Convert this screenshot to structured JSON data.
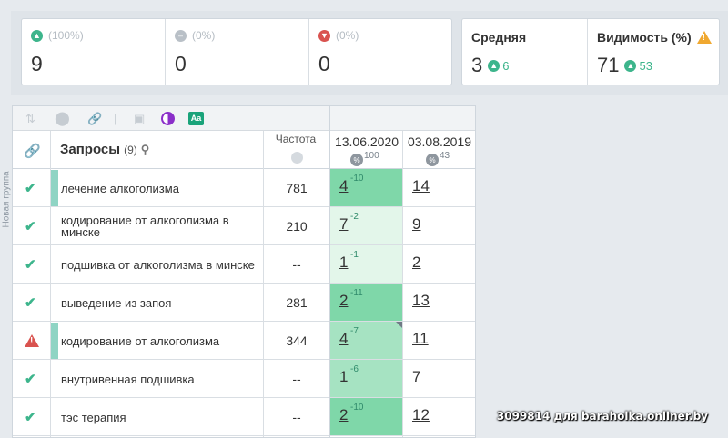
{
  "stats": {
    "up": {
      "pct": "(100%)",
      "value": "9"
    },
    "flat": {
      "pct": "(0%)",
      "value": "0"
    },
    "down": {
      "pct": "(0%)",
      "value": "0"
    }
  },
  "average": {
    "label": "Средняя",
    "value": "3",
    "delta": "6"
  },
  "visibility": {
    "label": "Видимость (%)",
    "value": "71",
    "delta": "53"
  },
  "sidebar": {
    "group_label": "Новая группа"
  },
  "table": {
    "query_title": "Запросы",
    "query_count": "(9)",
    "freq_header": "Частота",
    "date1": "13.06.2020",
    "date1_badge": "100",
    "date2": "03.08.2019",
    "date2_badge": "43",
    "rows": [
      {
        "status": "ok",
        "query": "лечение алкоголизма",
        "freq": "781",
        "pos1": "4",
        "delta1": "-10",
        "pos2": "14",
        "marker": true,
        "bg": "#7fd7a9"
      },
      {
        "status": "ok",
        "query": "кодирование от алкоголизма в минске",
        "freq": "210",
        "pos1": "7",
        "delta1": "-2",
        "pos2": "9",
        "marker": false,
        "bg": "#e3f6ea"
      },
      {
        "status": "ok",
        "query": "подшивка от алкоголизма в минске",
        "freq": "--",
        "pos1": "1",
        "delta1": "-1",
        "pos2": "2",
        "marker": false,
        "bg": "#e3f6ea"
      },
      {
        "status": "ok",
        "query": "выведение из запоя",
        "freq": "281",
        "pos1": "2",
        "delta1": "-11",
        "pos2": "13",
        "marker": false,
        "bg": "#7fd7a9"
      },
      {
        "status": "warn",
        "query": "кодирование от алкоголизма",
        "freq": "344",
        "pos1": "4",
        "delta1": "-7",
        "pos2": "11",
        "marker": true,
        "bg": "#a6e3c2"
      },
      {
        "status": "ok",
        "query": "внутривенная подшивка",
        "freq": "--",
        "pos1": "1",
        "delta1": "-6",
        "pos2": "7",
        "marker": false,
        "bg": "#a6e3c2"
      },
      {
        "status": "ok",
        "query": "тэс терапия",
        "freq": "--",
        "pos1": "2",
        "delta1": "-10",
        "pos2": "12",
        "marker": false,
        "bg": "#7fd7a9"
      }
    ]
  },
  "watermark": "3099814 для baraholka.onliner.by"
}
